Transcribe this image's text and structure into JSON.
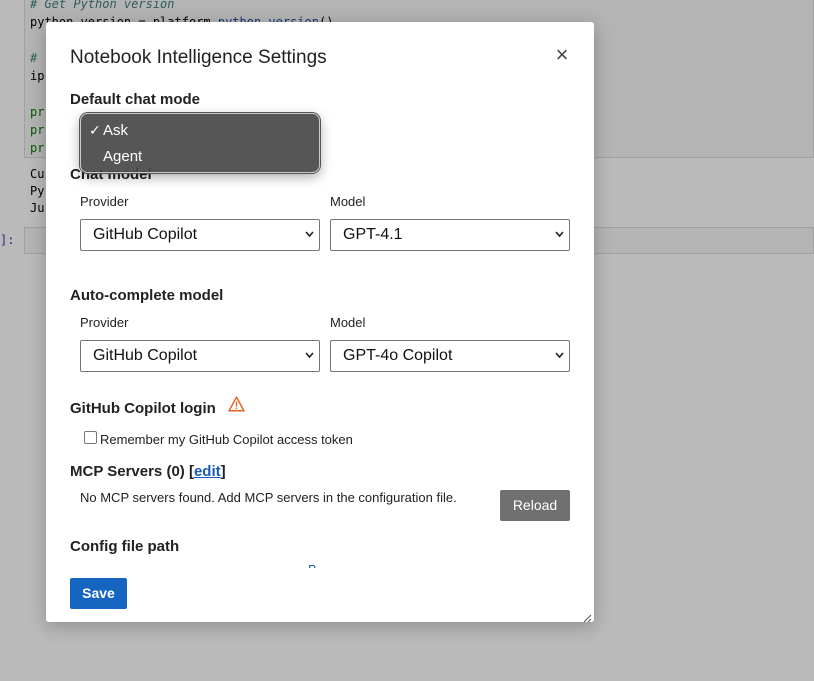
{
  "notebook": {
    "code_lines": [
      {
        "parts": [
          {
            "text": "# Get Python version",
            "cls": "c-comment"
          }
        ]
      },
      {
        "parts": [
          {
            "text": "python_version = platform.",
            "cls": ""
          },
          {
            "text": "python_version",
            "cls": "c-blue"
          },
          {
            "text": "()",
            "cls": ""
          }
        ]
      },
      {
        "parts": [
          {
            "text": "",
            "cls": ""
          }
        ]
      },
      {
        "parts": [
          {
            "text": "# ",
            "cls": "c-comment"
          }
        ]
      },
      {
        "parts": [
          {
            "text": "ip",
            "cls": ""
          }
        ]
      },
      {
        "parts": [
          {
            "text": "",
            "cls": ""
          }
        ]
      },
      {
        "parts": [
          {
            "text": "pr",
            "cls": "c-green"
          }
        ]
      },
      {
        "parts": [
          {
            "text": "pr",
            "cls": "c-green"
          }
        ]
      },
      {
        "parts": [
          {
            "text": "pr",
            "cls": "c-green"
          }
        ]
      }
    ],
    "output_lines": [
      "Cu",
      "Py",
      "Ju"
    ],
    "empty_prompt": "]:"
  },
  "dialog": {
    "title": "Notebook Intelligence Settings",
    "close_symbol": "×",
    "default_chat_mode": {
      "title": "Default chat mode",
      "options": [
        "Ask",
        "Agent"
      ],
      "selected": "Ask",
      "check_mark": "✓"
    },
    "chat_model": {
      "title": "Chat model",
      "provider_label": "Provider",
      "provider_value": "GitHub Copilot",
      "model_label": "Model",
      "model_value": "GPT-4.1"
    },
    "autocomplete_model": {
      "title": "Auto-complete model",
      "provider_label": "Provider",
      "provider_value": "GitHub Copilot",
      "model_label": "Model",
      "model_value": "GPT-4o Copilot"
    },
    "copilot_login": {
      "title": "GitHub Copilot login",
      "warning_icon": "warning-triangle-icon",
      "remember_label": "Remember my GitHub Copilot access token",
      "remember_checked": false
    },
    "mcp": {
      "title_prefix": "MCP Servers (0) [",
      "edit_link": "edit",
      "title_suffix": "]",
      "message": "No MCP servers found. Add MCP servers in the configuration file.",
      "reload_label": "Reload"
    },
    "config": {
      "title": "Config file path",
      "clipped_glyph": "B"
    },
    "save_label": "Save"
  },
  "colors": {
    "primary_button": "#1565c0",
    "secondary_button": "#707070",
    "link": "#1a5bb5",
    "warning": "#e0641f"
  }
}
